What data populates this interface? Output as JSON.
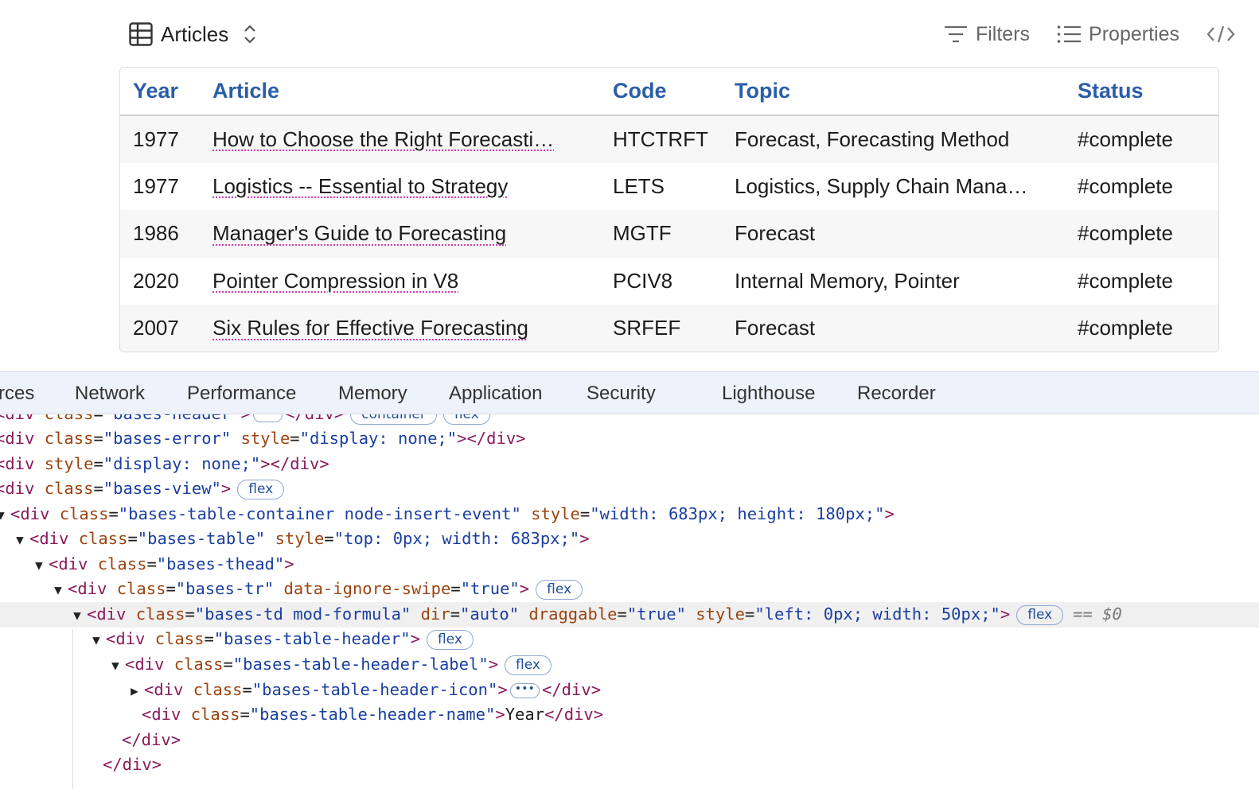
{
  "view": {
    "name": "Articles",
    "filters_label": "Filters",
    "properties_label": "Properties",
    "columns": [
      "Year",
      "Article",
      "Code",
      "Topic",
      "Status"
    ],
    "rows": [
      {
        "year": "1977",
        "article": "How to Choose the Right Forecasti…",
        "code": "HTCTRFT",
        "topic": "Forecast, Forecasting Method",
        "status": "#complete"
      },
      {
        "year": "1977",
        "article": "Logistics -- Essential to Strategy",
        "code": "LETS",
        "topic": "Logistics, Supply Chain Mana…",
        "status": "#complete"
      },
      {
        "year": "1986",
        "article": "Manager's Guide to Forecasting",
        "code": "MGTF",
        "topic": "Forecast",
        "status": "#complete"
      },
      {
        "year": "2020",
        "article": "Pointer Compression in V8",
        "code": "PCIV8",
        "topic": "Internal Memory, Pointer",
        "status": "#complete"
      },
      {
        "year": "2007",
        "article": "Six Rules for Effective Forecasting",
        "code": "SRFEF",
        "topic": "Forecast",
        "status": "#complete"
      }
    ]
  },
  "devtools": {
    "tabs": [
      "rces",
      "Network",
      "Performance",
      "Memory",
      "Application",
      "Security",
      "Lighthouse",
      "Recorder"
    ],
    "badges": {
      "flex": "flex",
      "container": "container",
      "dollar": "== $0"
    },
    "lines": [
      {
        "open": "div",
        "attrs": [
          [
            "class",
            "bases-header"
          ]
        ],
        "suffix": "…</div>",
        "badges": [
          "container",
          "flex"
        ]
      },
      {
        "open": "div",
        "attrs": [
          [
            "class",
            "bases-error"
          ],
          [
            "style",
            "display: none;"
          ]
        ],
        "close": "</div>"
      },
      {
        "open": "div",
        "attrs": [
          [
            "style",
            "display: none;"
          ]
        ],
        "close": "</div>"
      },
      {
        "open": "div",
        "attrs": [
          [
            "class",
            "bases-view"
          ]
        ],
        "badges": [
          "flex"
        ]
      },
      {
        "open": "div",
        "attrs": [
          [
            "class",
            "bases-table-container node-insert-event"
          ],
          [
            "style",
            "width: 683px; height: 180px;"
          ]
        ]
      },
      {
        "open": "div",
        "attrs": [
          [
            "class",
            "bases-table"
          ],
          [
            "style",
            "top: 0px; width: 683px;"
          ]
        ]
      },
      {
        "open": "div",
        "attrs": [
          [
            "class",
            "bases-thead"
          ]
        ]
      },
      {
        "open": "div",
        "attrs": [
          [
            "class",
            "bases-tr"
          ],
          [
            "data-ignore-swipe",
            "true"
          ]
        ],
        "badges": [
          "flex"
        ]
      },
      {
        "open": "div",
        "attrs": [
          [
            "class",
            "bases-td mod-formula"
          ],
          [
            "dir",
            "auto"
          ],
          [
            "draggable",
            "true"
          ],
          [
            "style",
            "left: 0px; width: 50px;"
          ]
        ],
        "badges": [
          "flex"
        ],
        "selected": true
      },
      {
        "open": "div",
        "attrs": [
          [
            "class",
            "bases-table-header"
          ]
        ],
        "badges": [
          "flex"
        ]
      },
      {
        "open": "div",
        "attrs": [
          [
            "class",
            "bases-table-header-label"
          ]
        ],
        "badges": [
          "flex"
        ]
      },
      {
        "open": "div",
        "attrs": [
          [
            "class",
            "bases-table-header-icon"
          ]
        ],
        "collapsed": true
      },
      {
        "open": "div",
        "attrs": [
          [
            "class",
            "bases-table-header-name"
          ]
        ],
        "text": "Year",
        "close": "</div>"
      },
      {
        "closing": "</div>"
      },
      {
        "closing": "</div>"
      }
    ]
  }
}
